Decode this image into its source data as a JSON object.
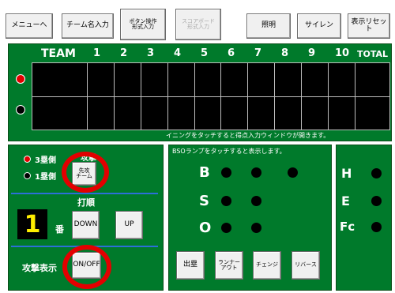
{
  "toolbar": {
    "menu": "メニューへ",
    "team_name": "チーム名入力",
    "button_op": "ボタン操作\n形式入力",
    "scoreboard": "スコアボード\n形式入力",
    "lighting": "照明",
    "siren": "サイレン",
    "display_reset": "表示リセット"
  },
  "scoreboard": {
    "team_header": "TEAM",
    "innings": [
      "1",
      "2",
      "3",
      "4",
      "5",
      "6",
      "7",
      "8",
      "9",
      "10"
    ],
    "total_header": "TOTAL",
    "hint": "イニングをタッチすると得点入力ウィンドウが開きます。"
  },
  "attack_panel": {
    "third_base": "3塁側",
    "first_base": "1塁側",
    "attack_label": "攻撃",
    "first_attack_button": "先攻\nチーム",
    "batting_order_label": "打順",
    "batter_number": "1",
    "ban": "番",
    "down": "DOWN",
    "up": "UP",
    "attack_display_label": "攻撃表示",
    "on_off": "ON/OFF"
  },
  "bso_panel": {
    "hint": "BSOランプをタッチすると表示します。",
    "b": "B",
    "s": "S",
    "o": "O",
    "buttons": {
      "shutsurui": "出塁",
      "runner_out": "ランナー\nアウト",
      "change": "チェンジ",
      "reverse": "リバース"
    }
  },
  "hef_panel": {
    "h": "H",
    "e": "E",
    "fc": "Fc"
  },
  "colors": {
    "panel_green": "#007a2b",
    "indicator_red": "#e30000",
    "highlight_ring": "#e30000",
    "digit_yellow": "#ffee00"
  }
}
